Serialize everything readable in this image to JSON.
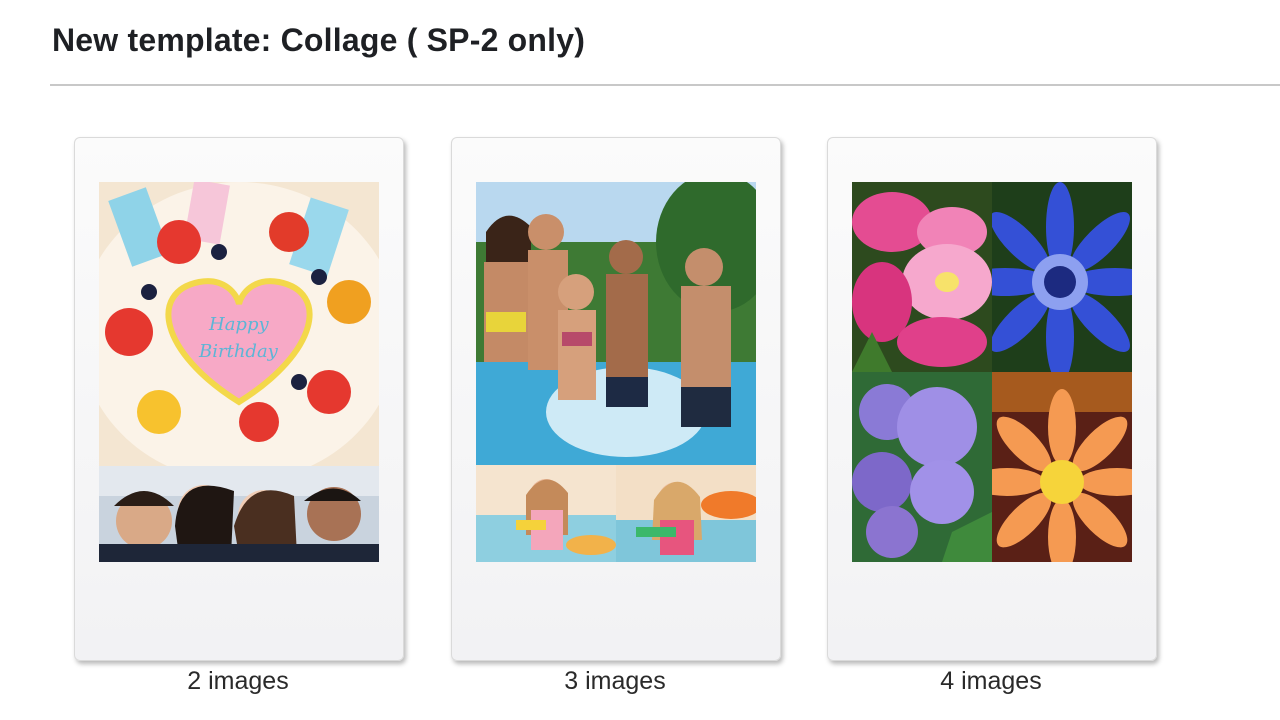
{
  "header": {
    "title": "New template: Collage ( SP-2 only)"
  },
  "templates": [
    {
      "caption": "2 images",
      "photos": [
        "birthday-cake-photo",
        "friends-selfie-photo"
      ]
    },
    {
      "caption": "3 images",
      "photos": [
        "pool-party-photo",
        "girl-water-gun-photo",
        "girl-splashing-photo"
      ]
    },
    {
      "caption": "4 images",
      "photos": [
        "pink-flower-photo",
        "blue-flower-photo",
        "hydrangea-photo",
        "orange-flower-photo"
      ]
    }
  ],
  "colors": {
    "title_text": "#1e2024",
    "divider": "#c8c8c8",
    "card_frame": "#f7f7f8",
    "caption_text": "#2a2a2a"
  }
}
